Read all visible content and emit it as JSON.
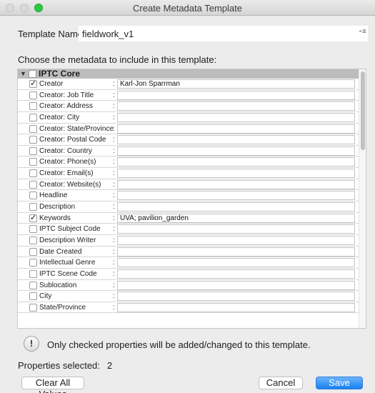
{
  "window": {
    "title": "Create Metadata Template"
  },
  "template_name": {
    "label": "Template Name:",
    "value": "fieldwork_v1"
  },
  "instruction": "Choose the metadata to include in this template:",
  "group": {
    "label": "IPTC Core",
    "checked": false,
    "expanded": true
  },
  "fields": [
    {
      "label": "Creator",
      "checked": true,
      "value": "Karl-Jon Sparrman"
    },
    {
      "label": "Creator: Job Title",
      "checked": false,
      "value": ""
    },
    {
      "label": "Creator: Address",
      "checked": false,
      "value": ""
    },
    {
      "label": "Creator: City",
      "checked": false,
      "value": ""
    },
    {
      "label": "Creator: State/Province",
      "checked": false,
      "value": ""
    },
    {
      "label": "Creator: Postal Code",
      "checked": false,
      "value": ""
    },
    {
      "label": "Creator: Country",
      "checked": false,
      "value": ""
    },
    {
      "label": "Creator: Phone(s)",
      "checked": false,
      "value": ""
    },
    {
      "label": "Creator: Email(s)",
      "checked": false,
      "value": ""
    },
    {
      "label": "Creator: Website(s)",
      "checked": false,
      "value": ""
    },
    {
      "label": "Headline",
      "checked": false,
      "value": ""
    },
    {
      "label": "Description",
      "checked": false,
      "value": ""
    },
    {
      "label": "Keywords",
      "checked": true,
      "value": "UVA; pavilion_garden"
    },
    {
      "label": "IPTC Subject Code",
      "checked": false,
      "value": ""
    },
    {
      "label": "Description Writer",
      "checked": false,
      "value": ""
    },
    {
      "label": "Date Created",
      "checked": false,
      "value": ""
    },
    {
      "label": "Intellectual Genre",
      "checked": false,
      "value": ""
    },
    {
      "label": "IPTC Scene Code",
      "checked": false,
      "value": ""
    },
    {
      "label": "Sublocation",
      "checked": false,
      "value": ""
    },
    {
      "label": "City",
      "checked": false,
      "value": ""
    },
    {
      "label": "State/Province",
      "checked": false,
      "value": ""
    }
  ],
  "note": "Only checked properties will be added/changed to this template.",
  "properties_selected": {
    "label": "Properties selected:",
    "count": "2"
  },
  "buttons": {
    "clear": "Clear All Values",
    "cancel": "Cancel",
    "save": "Save"
  },
  "glyphs": {
    "check": "✓",
    "disclosure": "▼",
    "info": "!",
    "menu": "⁃≡"
  },
  "colors": {
    "accent": "#1780f3",
    "zoom_button": "#2bc840"
  },
  "icons": {
    "info": "info-icon",
    "menu": "menu-icon",
    "disclosure": "disclosure-triangle-icon"
  }
}
